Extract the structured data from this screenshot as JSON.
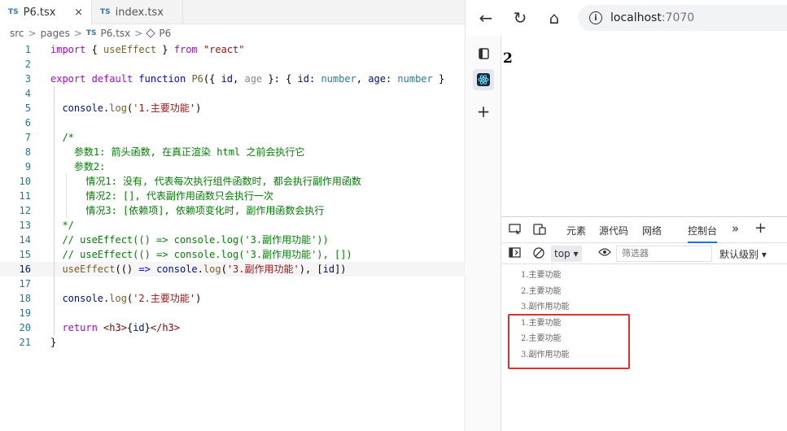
{
  "editor": {
    "tabs": [
      {
        "badge": "TS",
        "label": "P6.tsx",
        "close": "×",
        "active": true
      },
      {
        "badge": "TS",
        "label": "index.tsx",
        "active": false
      }
    ],
    "breadcrumb": {
      "parts": [
        "src",
        "pages",
        "P6.tsx",
        "P6"
      ],
      "file_badge": "TS",
      "sep": ">"
    },
    "current_line": 16
  },
  "browser": {
    "nav": {
      "back": "←",
      "reload": "↻",
      "home": "⌂"
    },
    "address": {
      "host": "localhost",
      "port": ":7070",
      "info": "i"
    },
    "page": {
      "h3": "2"
    },
    "side": {
      "add": "+"
    },
    "devtools": {
      "tabs": [
        "元素",
        "源代码",
        "网络",
        "控制台"
      ],
      "active_tab": "控制台",
      "more": "»",
      "add": "+",
      "context": "top",
      "filter_placeholder": "筛选器",
      "level": "默认级别"
    },
    "console_logs": [
      "1.主要功能",
      "2.主要功能",
      "3.副作用功能",
      "1.主要功能",
      "2.主要功能",
      "3.副作用功能"
    ]
  },
  "colors": {
    "highlight_box": "#e0322c",
    "ts_badge": "#3178c6",
    "keyword": "#0000ff",
    "string": "#a31515",
    "comment": "#008000"
  }
}
